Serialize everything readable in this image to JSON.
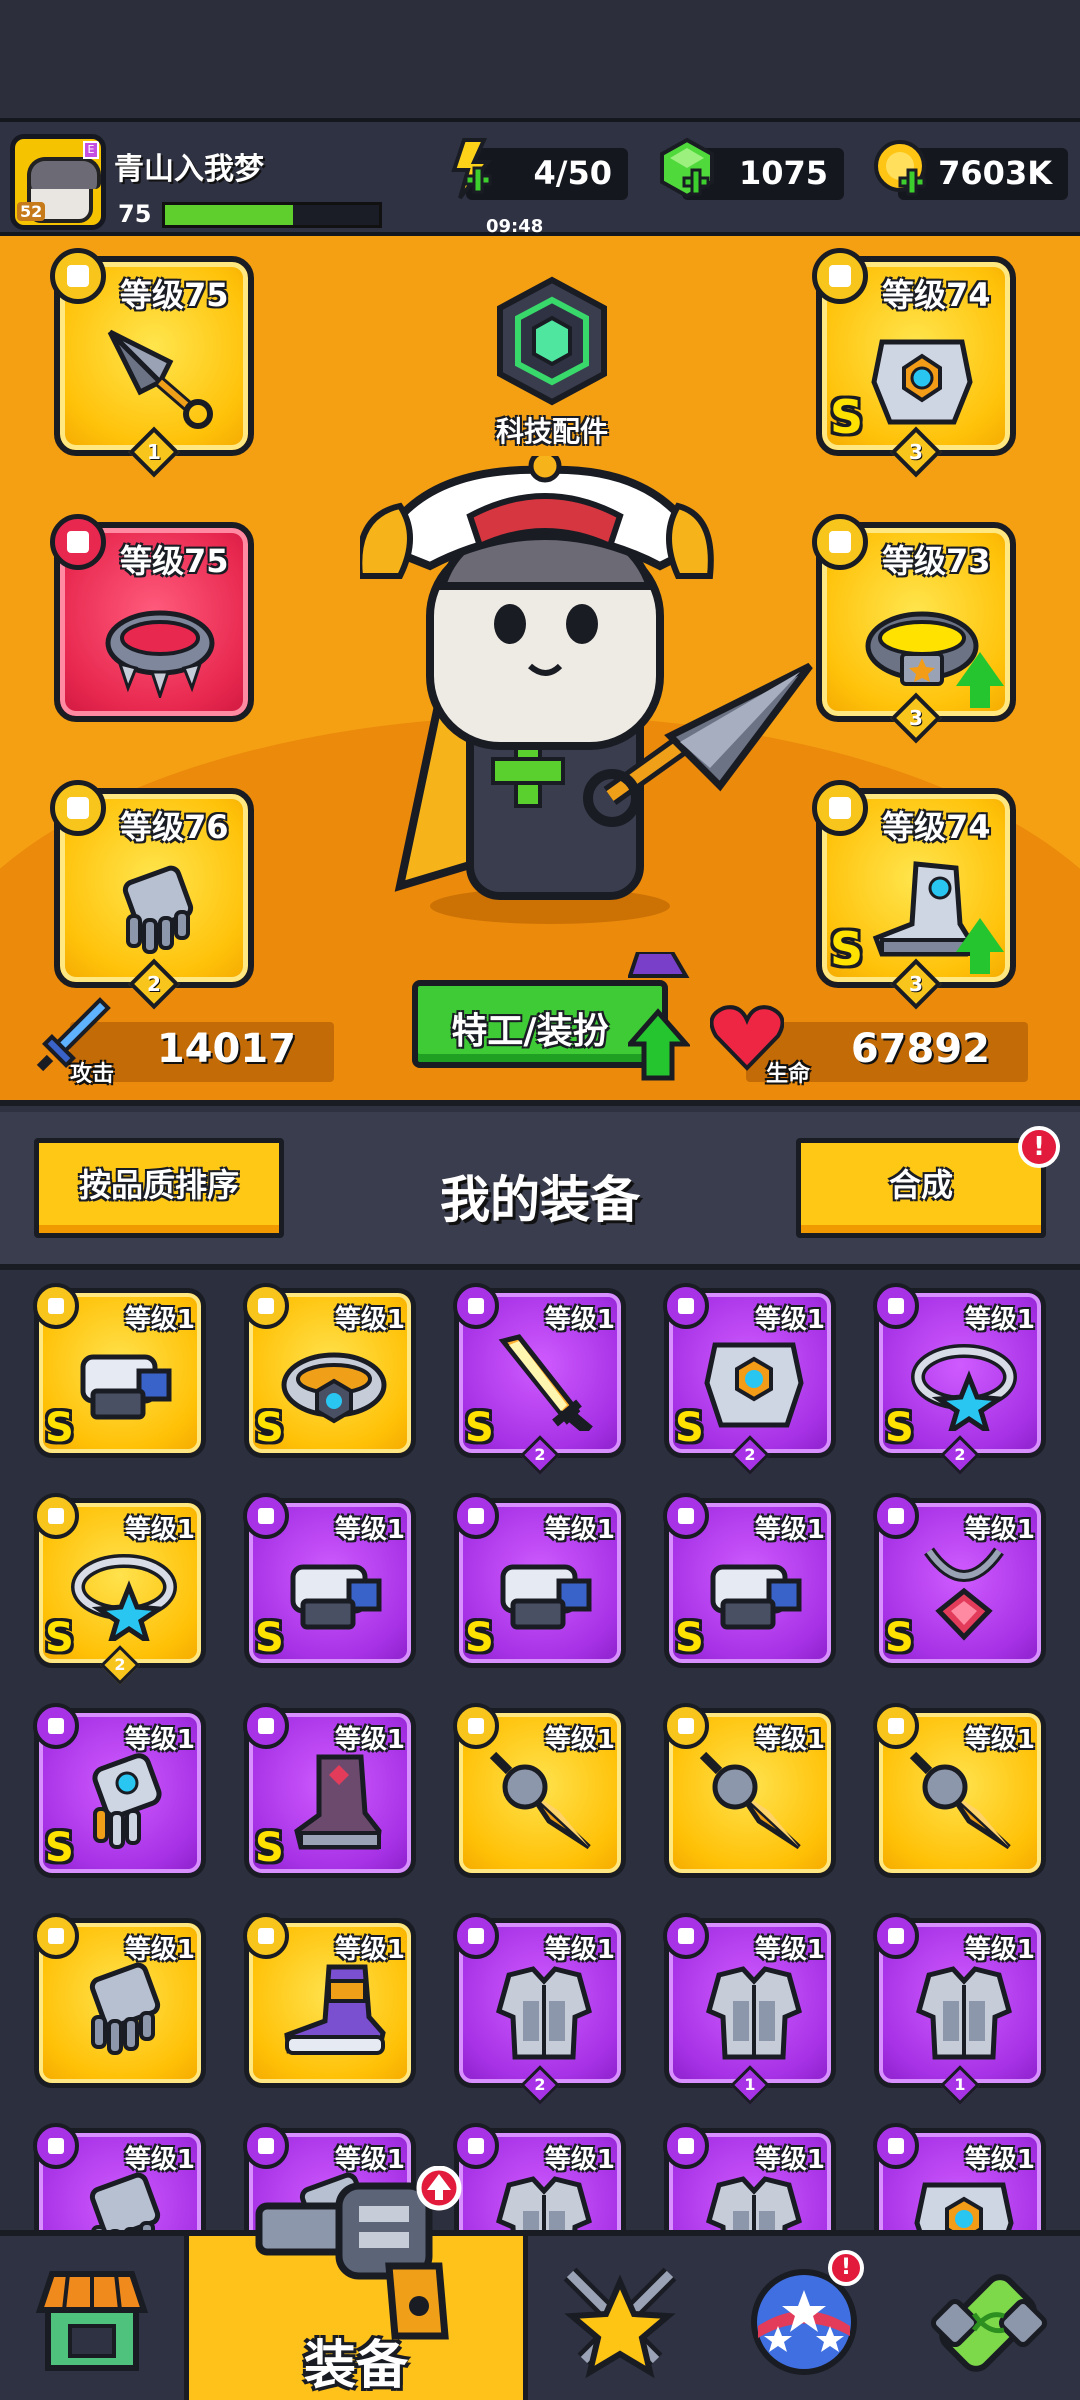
{
  "player": {
    "name": "青山入我梦",
    "level": "75",
    "avatar_level": "52",
    "avatar_tag": "E",
    "xp_fraction": 0.6
  },
  "resources": {
    "energy": {
      "value": "4/50",
      "timer": "09:48"
    },
    "gems": {
      "value": "1075"
    },
    "gold": {
      "value": "7603K"
    }
  },
  "tech_part": {
    "label": "科技配件"
  },
  "equipped": {
    "left": [
      {
        "level": "等级75",
        "stars": "1",
        "rarity": "gold",
        "icon": "kunai-icon"
      },
      {
        "level": "等级75",
        "stars": "",
        "rarity": "red",
        "icon": "spiked-collar-icon"
      },
      {
        "level": "等级76",
        "stars": "2",
        "rarity": "gold",
        "icon": "gauntlet-icon"
      }
    ],
    "right": [
      {
        "level": "等级74",
        "stars": "3",
        "grade": "S",
        "rarity": "gold",
        "icon": "mech-armor-icon"
      },
      {
        "level": "等级73",
        "stars": "3",
        "rarity": "gold",
        "icon": "star-belt-icon",
        "upgrade": true
      },
      {
        "level": "等级74",
        "stars": "3",
        "grade": "S",
        "rarity": "gold",
        "icon": "mech-boots-icon",
        "upgrade": true
      }
    ]
  },
  "stats": {
    "attack": {
      "label": "攻击",
      "value": "14017"
    },
    "hp": {
      "label": "生命",
      "value": "67892"
    }
  },
  "agent_button": {
    "label": "特工/装扮"
  },
  "equipment_header": {
    "sort_label": "按品质排序",
    "title": "我的装备",
    "merge_label": "合成",
    "merge_alert": "!"
  },
  "inventory": [
    {
      "level": "等级1",
      "grade": "S",
      "stars": "",
      "rarity": "gold",
      "icon": "blaster-icon"
    },
    {
      "level": "等级1",
      "grade": "S",
      "stars": "",
      "rarity": "gold",
      "icon": "tech-belt-icon"
    },
    {
      "level": "等级1",
      "grade": "S",
      "stars": "2",
      "rarity": "purple",
      "icon": "flame-sword-icon"
    },
    {
      "level": "等级1",
      "grade": "S",
      "stars": "2",
      "rarity": "purple",
      "icon": "mech-armor-icon"
    },
    {
      "level": "等级1",
      "grade": "S",
      "stars": "2",
      "rarity": "purple",
      "icon": "star-ring-icon"
    },
    {
      "level": "等级1",
      "grade": "S",
      "stars": "2",
      "rarity": "gold",
      "icon": "star-ring-icon"
    },
    {
      "level": "等级1",
      "grade": "S",
      "stars": "",
      "rarity": "purple",
      "icon": "blaster-icon"
    },
    {
      "level": "等级1",
      "grade": "S",
      "stars": "",
      "rarity": "purple",
      "icon": "blaster-icon"
    },
    {
      "level": "等级1",
      "grade": "S",
      "stars": "",
      "rarity": "purple",
      "icon": "blaster-icon"
    },
    {
      "level": "等级1",
      "grade": "S",
      "stars": "",
      "rarity": "purple",
      "icon": "gem-necklace-icon"
    },
    {
      "level": "等级1",
      "grade": "S",
      "stars": "",
      "rarity": "purple",
      "icon": "tech-gauntlet-icon"
    },
    {
      "level": "等级1",
      "grade": "S",
      "stars": "",
      "rarity": "purple",
      "icon": "spiked-boots-icon"
    },
    {
      "level": "等级1",
      "grade": "",
      "stars": "",
      "rarity": "gold",
      "icon": "drill-spear-icon"
    },
    {
      "level": "等级1",
      "grade": "",
      "stars": "",
      "rarity": "gold",
      "icon": "drill-spear-icon"
    },
    {
      "level": "等级1",
      "grade": "",
      "stars": "",
      "rarity": "gold",
      "icon": "drill-spear-icon"
    },
    {
      "level": "等级1",
      "grade": "",
      "stars": "",
      "rarity": "gold",
      "icon": "gauntlet-icon"
    },
    {
      "level": "等级1",
      "grade": "",
      "stars": "",
      "rarity": "gold",
      "icon": "sneaker-icon"
    },
    {
      "level": "等级1",
      "grade": "",
      "stars": "2",
      "rarity": "purple",
      "icon": "plate-armor-icon"
    },
    {
      "level": "等级1",
      "grade": "",
      "stars": "1",
      "rarity": "purple",
      "icon": "plate-armor-icon"
    },
    {
      "level": "等级1",
      "grade": "",
      "stars": "1",
      "rarity": "purple",
      "icon": "plate-armor-icon"
    },
    {
      "level": "等级1",
      "grade": "",
      "stars": "",
      "rarity": "purple",
      "icon": "gauntlet-icon"
    },
    {
      "level": "等级1",
      "grade": "",
      "stars": "",
      "rarity": "purple",
      "icon": "gauntlet-icon"
    },
    {
      "level": "等级1",
      "grade": "",
      "stars": "",
      "rarity": "purple",
      "icon": "plate-armor-icon"
    },
    {
      "level": "等级1",
      "grade": "",
      "stars": "",
      "rarity": "purple",
      "icon": "plate-armor-icon"
    },
    {
      "level": "等级1",
      "grade": "",
      "stars": "",
      "rarity": "purple",
      "icon": "mech-armor-icon"
    }
  ],
  "nav": [
    {
      "id": "shop",
      "icon": "shop-icon",
      "label": ""
    },
    {
      "id": "equipment",
      "icon": "revolver-icon",
      "label": "装备",
      "selected": true
    },
    {
      "id": "battle",
      "icon": "crossed-swords-star-icon",
      "label": ""
    },
    {
      "id": "talents",
      "icon": "star-ball-icon",
      "label": "",
      "alert": "!"
    },
    {
      "id": "dna",
      "icon": "dna-capsule-icon",
      "label": ""
    }
  ],
  "colors": {
    "gold_rarity": "#ffc107",
    "purple_rarity": "#a732e6",
    "red_rarity": "#e8284f",
    "panel": "#f5a012",
    "upgrade": "#24c52f"
  }
}
